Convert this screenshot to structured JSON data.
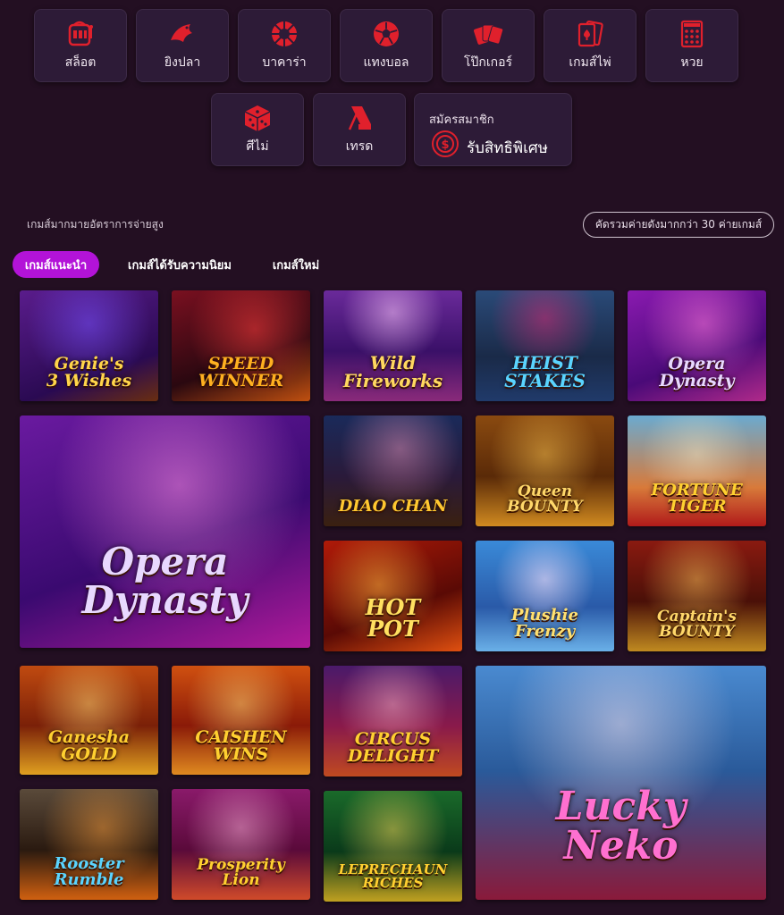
{
  "categories_row1": [
    {
      "label": "สล็อต",
      "icon": "slot-machine-icon"
    },
    {
      "label": "ยิงปลา",
      "icon": "fish-icon"
    },
    {
      "label": "บาคาร่า",
      "icon": "baccarat-wheel-icon"
    },
    {
      "label": "แทงบอล",
      "icon": "soccer-ball-icon"
    },
    {
      "label": "โป๊กเกอร์",
      "icon": "poker-cards-icon"
    },
    {
      "label": "เกมส์ไพ่",
      "icon": "card-game-icon"
    },
    {
      "label": "หวย",
      "icon": "lottery-ticket-icon"
    }
  ],
  "categories_row2": [
    {
      "label": "ศีไม่",
      "icon": "dice-icon"
    },
    {
      "label": "เทรด",
      "icon": "trade-icon"
    }
  ],
  "member": {
    "subtitle": "สมัครสมาชิก",
    "title": "รับสิทธิพิเศษ",
    "icon": "coin-icon"
  },
  "section": {
    "title": "เกมส์มากมายอัตราการจ่ายสูง",
    "more_button": "คัดรวมค่ายดังมากกว่า 30 ค่ายเกมส์"
  },
  "tabs": [
    "เกมส์แนะนำ",
    "เกมส์ได้รับความนิยม",
    "เกมส์ใหม่"
  ],
  "accent_color": "#b313d8",
  "icon_color": "#e0202c",
  "games": [
    "Genie's\n3 Wishes",
    "SPEED\nWINNER",
    "Wild\nFireworks",
    "HEIST\nSTAKES",
    "Opera\nDynasty",
    "Opera\nDynasty",
    "DIAO CHAN",
    "Queen\nBOUNTY",
    "FORTUNE\nTIGER",
    "HOT\nPOT",
    "Plushie\nFrenzy",
    "Captain's\nBOUNTY",
    "Ganesha\nGOLD",
    "CAISHEN\nWINS",
    "CIRCUS\nDELIGHT",
    "Lucky\nNeko",
    "Rooster\nRumble",
    "Prosperity\nLion",
    "LEPRECHAUN\nRICHES"
  ]
}
